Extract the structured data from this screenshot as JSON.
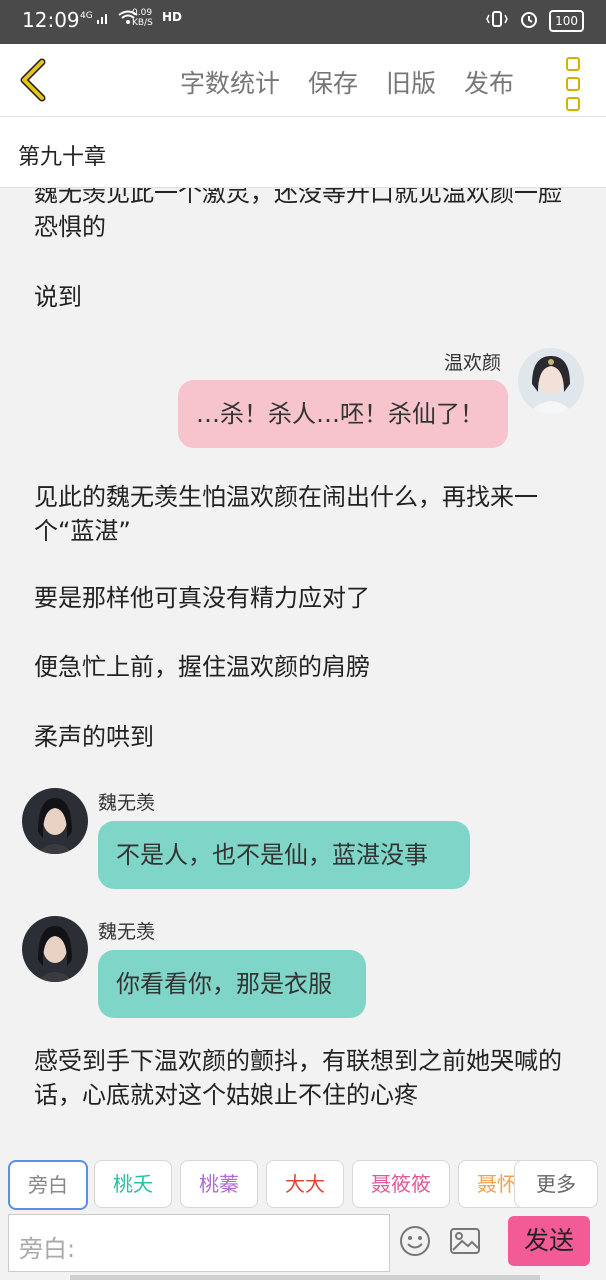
{
  "status": {
    "time": "12:09",
    "net": "4G",
    "speed_value": "0.09",
    "speed_unit": "KB/S",
    "hd": "HD",
    "battery": "100"
  },
  "toolbar": {
    "word_count": "字数统计",
    "save": "保存",
    "old_version": "旧版",
    "publish": "发布"
  },
  "chapter": {
    "title": "第九十章"
  },
  "content": {
    "para1": "魏无羡见此一个激灵，还没等开口就见温欢颜一脸恐惧的",
    "para2": "说到",
    "msg1": {
      "name": "温欢颜",
      "text": "…杀！杀人…呸！杀仙了！"
    },
    "para3": "见此的魏无羡生怕温欢颜在闹出什么，再找来一个“蓝湛”",
    "para4": "要是那样他可真没有精力应对了",
    "para5": "便急忙上前，握住温欢颜的肩膀",
    "para6": "柔声的哄到",
    "msg2": {
      "name": "魏无羡",
      "text": "不是人，也不是仙，蓝湛没事"
    },
    "msg3": {
      "name": "魏无羡",
      "text": "你看看你，那是衣服"
    },
    "para7": "感受到手下温欢颜的颤抖，有联想到之前她哭喊的话，心底就对这个姑娘止不住的心疼"
  },
  "roles": [
    {
      "label": "旁白",
      "color": "#888888"
    },
    {
      "label": "桃夭",
      "color": "#2cbfa6"
    },
    {
      "label": "桃蓁",
      "color": "#b06ad6"
    },
    {
      "label": "大大",
      "color": "#e0453a"
    },
    {
      "label": "聂筱筱",
      "color": "#e2589a"
    },
    {
      "label": "聂怀",
      "color": "#f0a24a"
    }
  ],
  "more": "更多",
  "input": {
    "placeholder": "旁白:"
  },
  "send": "发送"
}
